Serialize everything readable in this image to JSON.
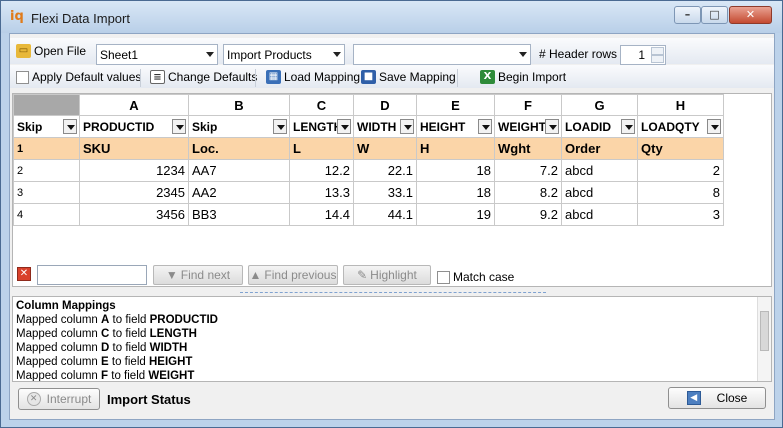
{
  "window": {
    "title": "Flexi Data Import",
    "icon": "iq-app-icon"
  },
  "toolbar1": {
    "open_file": "Open File",
    "sheet_select": "Sheet1",
    "profile_select": "Import Products",
    "blank_select": "",
    "header_rows_label": "# Header rows",
    "header_rows_value": "1"
  },
  "toolbar2": {
    "apply_default_values": "Apply Default values",
    "change_defaults": "Change Defaults",
    "load_mapping": "Load Mapping",
    "save_mapping": "Save Mapping",
    "begin_import": "Begin Import"
  },
  "grid": {
    "column_letters": [
      "A",
      "B",
      "C",
      "D",
      "E",
      "F",
      "G",
      "H"
    ],
    "mapping_row": {
      "row_label": "Skip",
      "fields": [
        "PRODUCTID",
        "Skip",
        "LENGTH",
        "WIDTH",
        "HEIGHT",
        "WEIGHT",
        "LOADID",
        "LOADQTY"
      ]
    },
    "rows": [
      {
        "num": "1",
        "cells": [
          "SKU",
          "Loc.",
          "L",
          "W",
          "H",
          "Wght",
          "Order",
          "Qty"
        ]
      },
      {
        "num": "2",
        "cells": [
          "1234",
          "AA7",
          "12.2",
          "22.1",
          "18",
          "7.2",
          "abcd",
          "2"
        ]
      },
      {
        "num": "3",
        "cells": [
          "2345",
          "AA2",
          "13.3",
          "33.1",
          "18",
          "8.2",
          "abcd",
          "8"
        ]
      },
      {
        "num": "4",
        "cells": [
          "3456",
          "BB3",
          "14.4",
          "44.1",
          "19",
          "9.2",
          "abcd",
          "3"
        ]
      }
    ]
  },
  "find": {
    "input_value": "",
    "find_next": "Find next",
    "find_previous": "Find previous",
    "highlight": "Highlight",
    "match_case": "Match case"
  },
  "log": {
    "heading": "Column Mappings",
    "lines": [
      {
        "pre": "Mapped column ",
        "col": "A",
        "mid": " to field ",
        "field": "PRODUCTID"
      },
      {
        "pre": "Mapped column ",
        "col": "C",
        "mid": " to field ",
        "field": "LENGTH"
      },
      {
        "pre": "Mapped column ",
        "col": "D",
        "mid": " to field ",
        "field": "WIDTH"
      },
      {
        "pre": "Mapped column ",
        "col": "E",
        "mid": " to field ",
        "field": "HEIGHT"
      },
      {
        "pre": "Mapped column ",
        "col": "F",
        "mid": " to field ",
        "field": "WEIGHT"
      }
    ]
  },
  "bottom": {
    "interrupt": "Interrupt",
    "status_label": "Import Status",
    "close": "Close"
  }
}
